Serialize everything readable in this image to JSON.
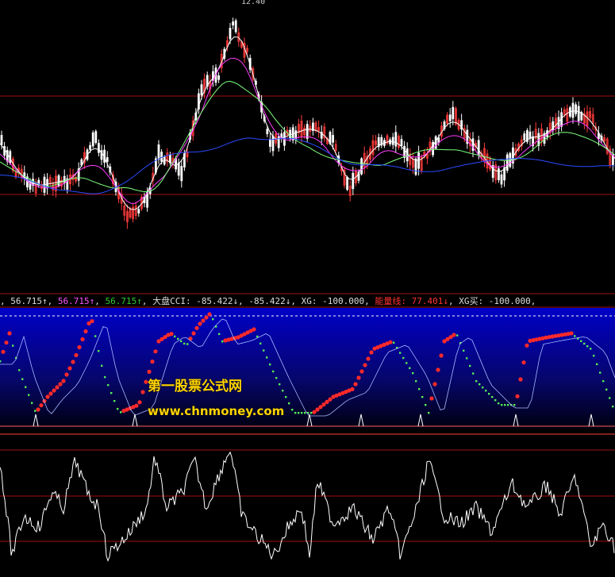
{
  "legend": [
    {
      "text": "",
      "color": "#dddddd"
    },
    {
      "text": "56.715↑",
      "color": "#dddddd"
    },
    {
      "text": "56.715↑",
      "color": "#ff55ff"
    },
    {
      "text": "56.715↑",
      "color": "#33cc33"
    },
    {
      "text": "大盘CCI: -85.422↓",
      "color": "#dddddd"
    },
    {
      "text": "-85.422↓",
      "color": "#dddddd"
    },
    {
      "text": "XG: -100.000",
      "color": "#dddddd"
    },
    {
      "text": "能量线: 77.401↓",
      "color": "#ff3333"
    },
    {
      "text": "XG买: -100.000",
      "color": "#dddddd"
    }
  ],
  "peak_label": "12.40",
  "watermark": {
    "line1": "第一股票公式网",
    "line2": "www.chnmoney.com"
  },
  "colors": {
    "up_candle": "#ff3b3b",
    "down_candle": "#ffffff",
    "ma_white": "#ffffff",
    "ma_pink": "#ff3cff",
    "ma_green": "#7cff7c",
    "ma_blue": "#2b4bff",
    "ma_yellow": "#e8e84a",
    "energy_red": "#ff2a2a",
    "energy_green": "#55ee55",
    "ref_line": "#a8b8ff"
  },
  "chart_data": [
    {
      "type": "candlestick",
      "title": "",
      "annotations": [
        "12.40"
      ]
    },
    {
      "type": "line",
      "title": "",
      "series": [
        {
          "name": "能量线",
          "last": 77.401
        },
        {
          "name": "大盘CCI",
          "last": -85.422
        }
      ]
    },
    {
      "type": "line",
      "title": "",
      "series": [
        {
          "name": "",
          "values": []
        }
      ]
    }
  ]
}
